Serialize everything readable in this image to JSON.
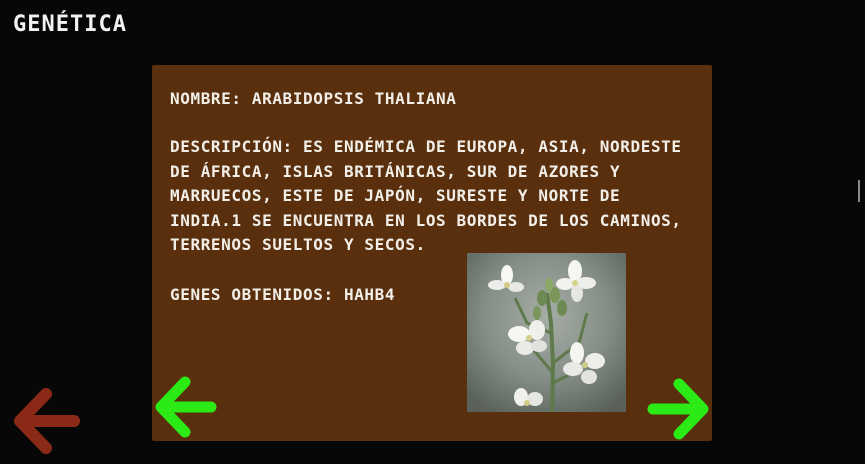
{
  "header": {
    "title": "GENÉTICA"
  },
  "card": {
    "name": "NOMBRE: ARABIDOPSIS THALIANA",
    "description": "DESCRIPCIÓN: ES ENDÉMICA DE EUROPA, ASIA, NORDESTE DE ÁFRICA, ISLAS BRITÁNICAS, SUR DE AZORES Y MARRUECOS, ESTE DE JAPÓN, SURESTE Y NORTE DE INDIA.1 SE ENCUENTRA EN LOS BORDES DE LOS CAMINOS, TERRENOS SUELTOS Y SECOS.",
    "genes": "GENES OBTENIDOS: HAHB4"
  },
  "image": {
    "subject": "white Arabidopsis flowers photo"
  },
  "colors": {
    "background": "#070707",
    "panel": "#5a2f0e",
    "text": "#f1efe8",
    "arrow_back": "#8a2a16",
    "arrow_nav": "#2bea16"
  },
  "icons": {
    "back": "arrow-left-icon",
    "previous": "arrow-left-icon",
    "next": "arrow-right-icon"
  }
}
